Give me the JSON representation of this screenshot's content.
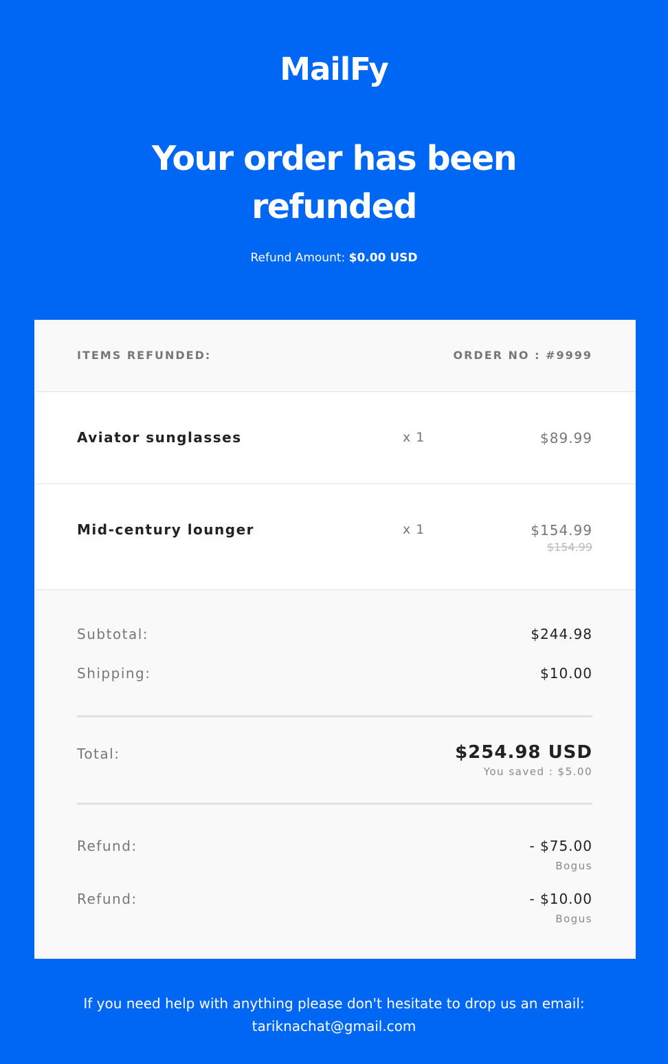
{
  "brand": {
    "logo": "MailFy"
  },
  "hero": {
    "headline": "Your order has been refunded",
    "refund_label": "Refund Amount:",
    "refund_value": "$0.00 USD"
  },
  "table": {
    "items_header": "ITEMS REFUNDED:",
    "order_header": "ORDER NO : #9999",
    "items": [
      {
        "name": "Aviator sunglasses",
        "qty": "x 1",
        "price": "$89.99",
        "old_price": ""
      },
      {
        "name": "Mid-century lounger",
        "qty": "x 1",
        "price": "$154.99",
        "old_price": "$154.99"
      }
    ]
  },
  "summary": {
    "subtotal_label": "Subtotal:",
    "subtotal_value": "$244.98",
    "shipping_label": "Shipping:",
    "shipping_value": "$10.00",
    "total_label": "Total:",
    "total_value": "$254.98 USD",
    "saved_note": "You saved : $5.00",
    "refunds": [
      {
        "label": "Refund:",
        "value": "- $75.00",
        "note": "Bogus"
      },
      {
        "label": "Refund:",
        "value": "- $10.00",
        "note": "Bogus"
      }
    ]
  },
  "footer": {
    "help_text": "If you need help with anything please don't hesitate to drop us an email:",
    "email": "tariknachat@gmail.com"
  },
  "colors": {
    "background": "#0067f4",
    "card": "#ffffff",
    "panel": "#f9f9f9"
  }
}
